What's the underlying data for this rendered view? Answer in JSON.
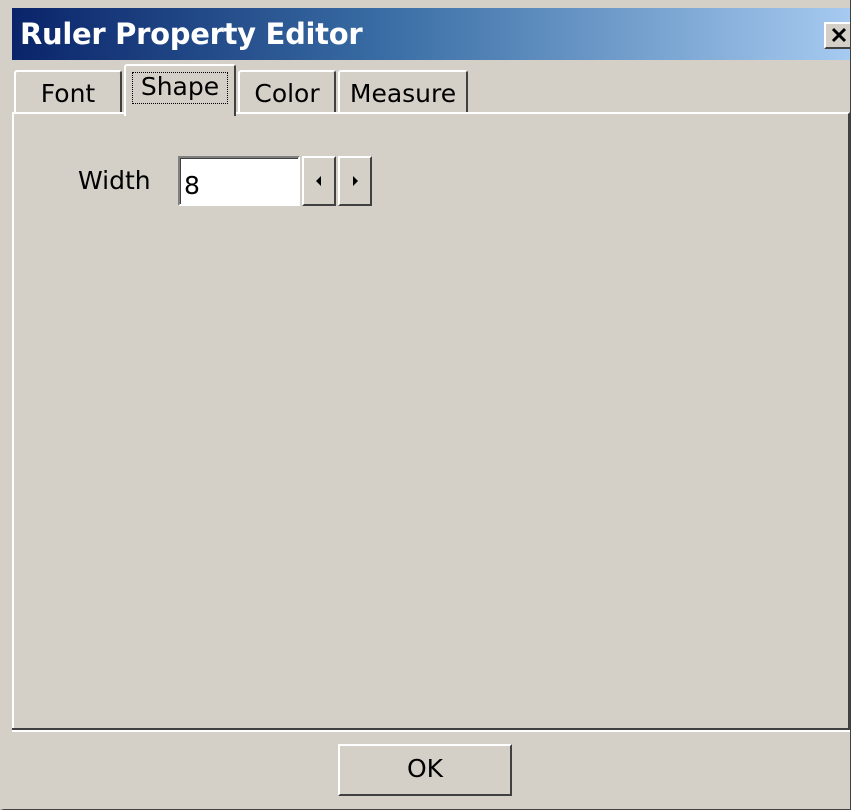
{
  "window": {
    "title": "Ruler Property Editor",
    "close_icon": "close-icon"
  },
  "tabs": [
    {
      "label": "Font",
      "active": false
    },
    {
      "label": "Shape",
      "active": true
    },
    {
      "label": "Color",
      "active": false
    },
    {
      "label": "Measure",
      "active": false
    }
  ],
  "shape": {
    "width_label": "Width",
    "width_value": "8",
    "spin_left_icon": "arrow-left-icon",
    "spin_right_icon": "arrow-right-icon"
  },
  "footer": {
    "ok_label": "OK"
  },
  "colors": {
    "title_gradient_start": "#0a246a",
    "title_gradient_end": "#a6caf0",
    "face": "#d4d0c8"
  }
}
